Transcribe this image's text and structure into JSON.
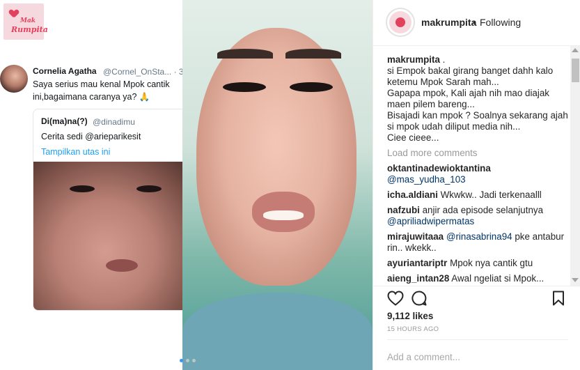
{
  "tweet": {
    "author": "Cornelia Agatha",
    "handle": "@Cornel_OnSta...",
    "more": "· 3",
    "text": "Saya serius mau kenal Mpok cantik ini,bagaimana caranya ya? 🙏",
    "quote": {
      "author": "Di(ma)na(?)",
      "handle": "@dinadimu",
      "text": "Cerita sedi @arieparikesit",
      "thread_link": "Tampilkan utas ini"
    }
  },
  "brand": {
    "logo_text": [
      "Mak",
      "Rumpita"
    ]
  },
  "post": {
    "username": "makrumpita",
    "follow_separator": "•",
    "follow_status": "Following",
    "caption_user": "makrumpita",
    "caption_lines": [
      " .",
      "si Empok bakal girang banget dahh kalo ketemu Mpok Sarah mah...",
      "Gapapa mpok, Kali ajah nih mao diajak maen pilem bareng...",
      "Bisajadi kan mpok ? Soalnya sekarang ajah si mpok udah diliput media nih...",
      "Ciee cieee..."
    ],
    "load_more": "Load more comments",
    "comments": [
      {
        "user": "oktantinadewioktantina",
        "text": "",
        "mention": "@mas_yudha_103"
      },
      {
        "user": "icha.aldiani",
        "text": "Wkwkw.. Jadi terkenaalll",
        "mention": ""
      },
      {
        "user": "nafzubi",
        "text": "anjir ada episode selanjutnya",
        "mention": "@apriliadwipermatas"
      },
      {
        "user": "mirajuwitaaa",
        "text": "pke antabur rin.. wkekk..",
        "mention": "@rinasabrina94"
      },
      {
        "user": "ayuriantariptr",
        "text": "Mpok nya cantik gtu",
        "mention": ""
      },
      {
        "user": "aieng_intan28",
        "text": "Awal ngeliat si Mpok...",
        "mention": ""
      }
    ],
    "likes": "9,112 likes",
    "time": "15 hours ago",
    "comment_placeholder": "Add a comment...",
    "icons": [
      "heart-icon",
      "comment-icon",
      "bookmark-icon"
    ]
  },
  "colors": {
    "link": "#003569",
    "muted": "#999999",
    "twitter_blue": "#1da1f2",
    "brand_pink": "#e2415e"
  }
}
